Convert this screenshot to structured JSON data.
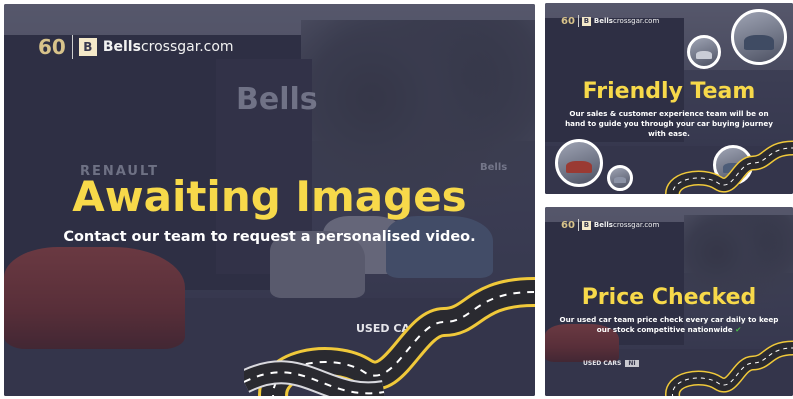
{
  "logo": {
    "anniversary": "60",
    "mark": "B",
    "brand_bold": "Bells",
    "brand_rest": "crossgar.com"
  },
  "main_tile": {
    "headline": "Awaiting Images",
    "subline": "Contact our team to request a personalised video.",
    "sign_text": "Bells",
    "sign_text_small": "Bells",
    "dealer_sign": "RENAULT",
    "badge_used": "USED CARS",
    "badge_ni": "NI"
  },
  "team_tile": {
    "headline": "Friendly Team",
    "subline": "Our sales & customer experience team will be on hand to guide you through your car buying journey with ease."
  },
  "price_tile": {
    "headline": "Price Checked",
    "subline": "Our used car team price check every car daily to keep our stock competitive nationwide",
    "check_glyph": "✔",
    "badge_used": "USED CARS",
    "badge_ni": "NI"
  },
  "colors": {
    "headline_yellow": "#f7d94a",
    "overlay_navy": "#303048",
    "check_green": "#4cc24a"
  }
}
